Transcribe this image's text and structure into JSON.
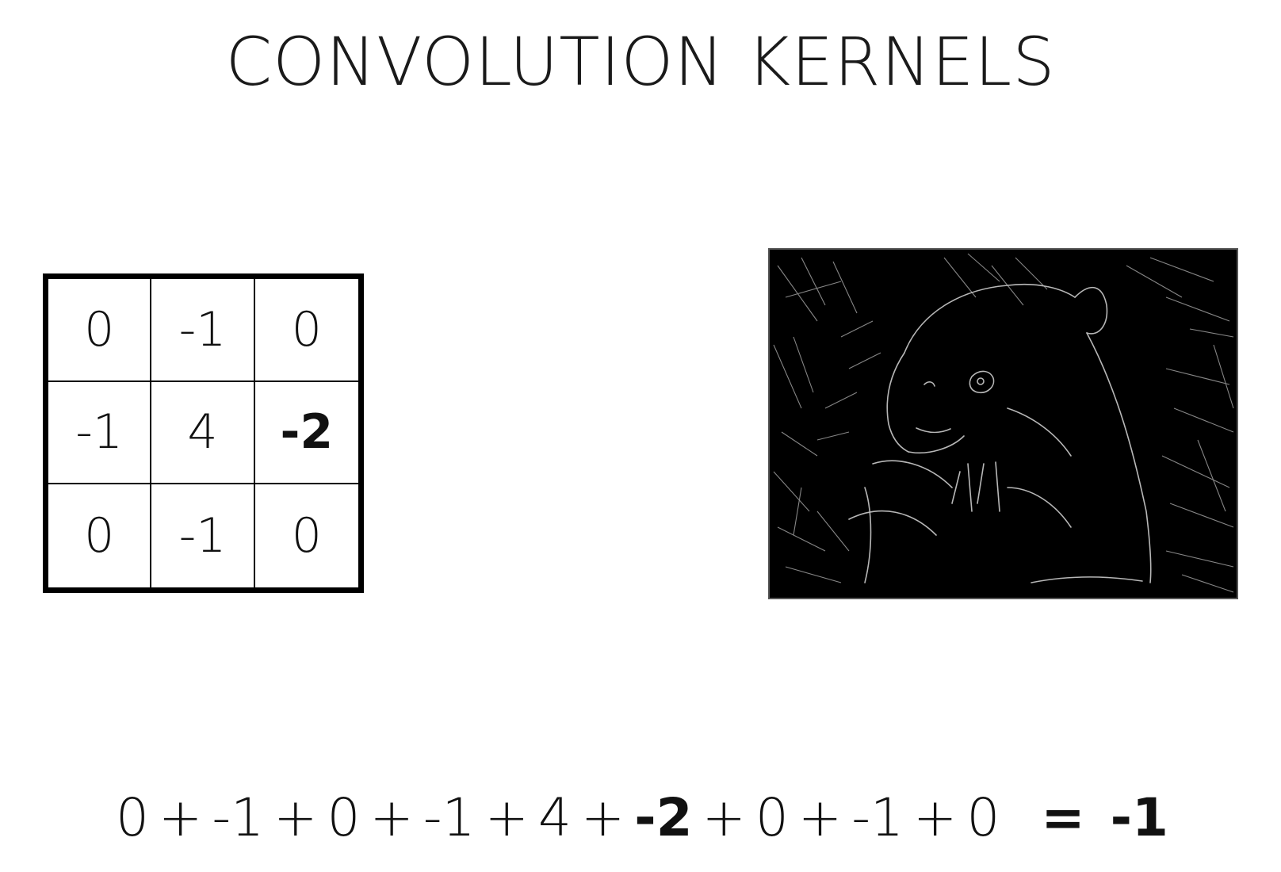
{
  "title": "CONVOLUTION KERNELS",
  "kernel": {
    "rows": [
      [
        "0",
        "-1",
        "0"
      ],
      [
        "-1",
        "4",
        "-2"
      ],
      [
        "0",
        "-1",
        "0"
      ]
    ],
    "bold_cells": [
      "1-2"
    ]
  },
  "edge_image": {
    "icon": "edge-detected-panda-image"
  },
  "equation": {
    "terms": [
      "0",
      "-1",
      "0",
      "-1",
      "4",
      "-2",
      "0",
      "-1",
      "0"
    ],
    "operator": "+",
    "bold_terms": [
      5
    ],
    "equals": "=",
    "result": "-1"
  }
}
